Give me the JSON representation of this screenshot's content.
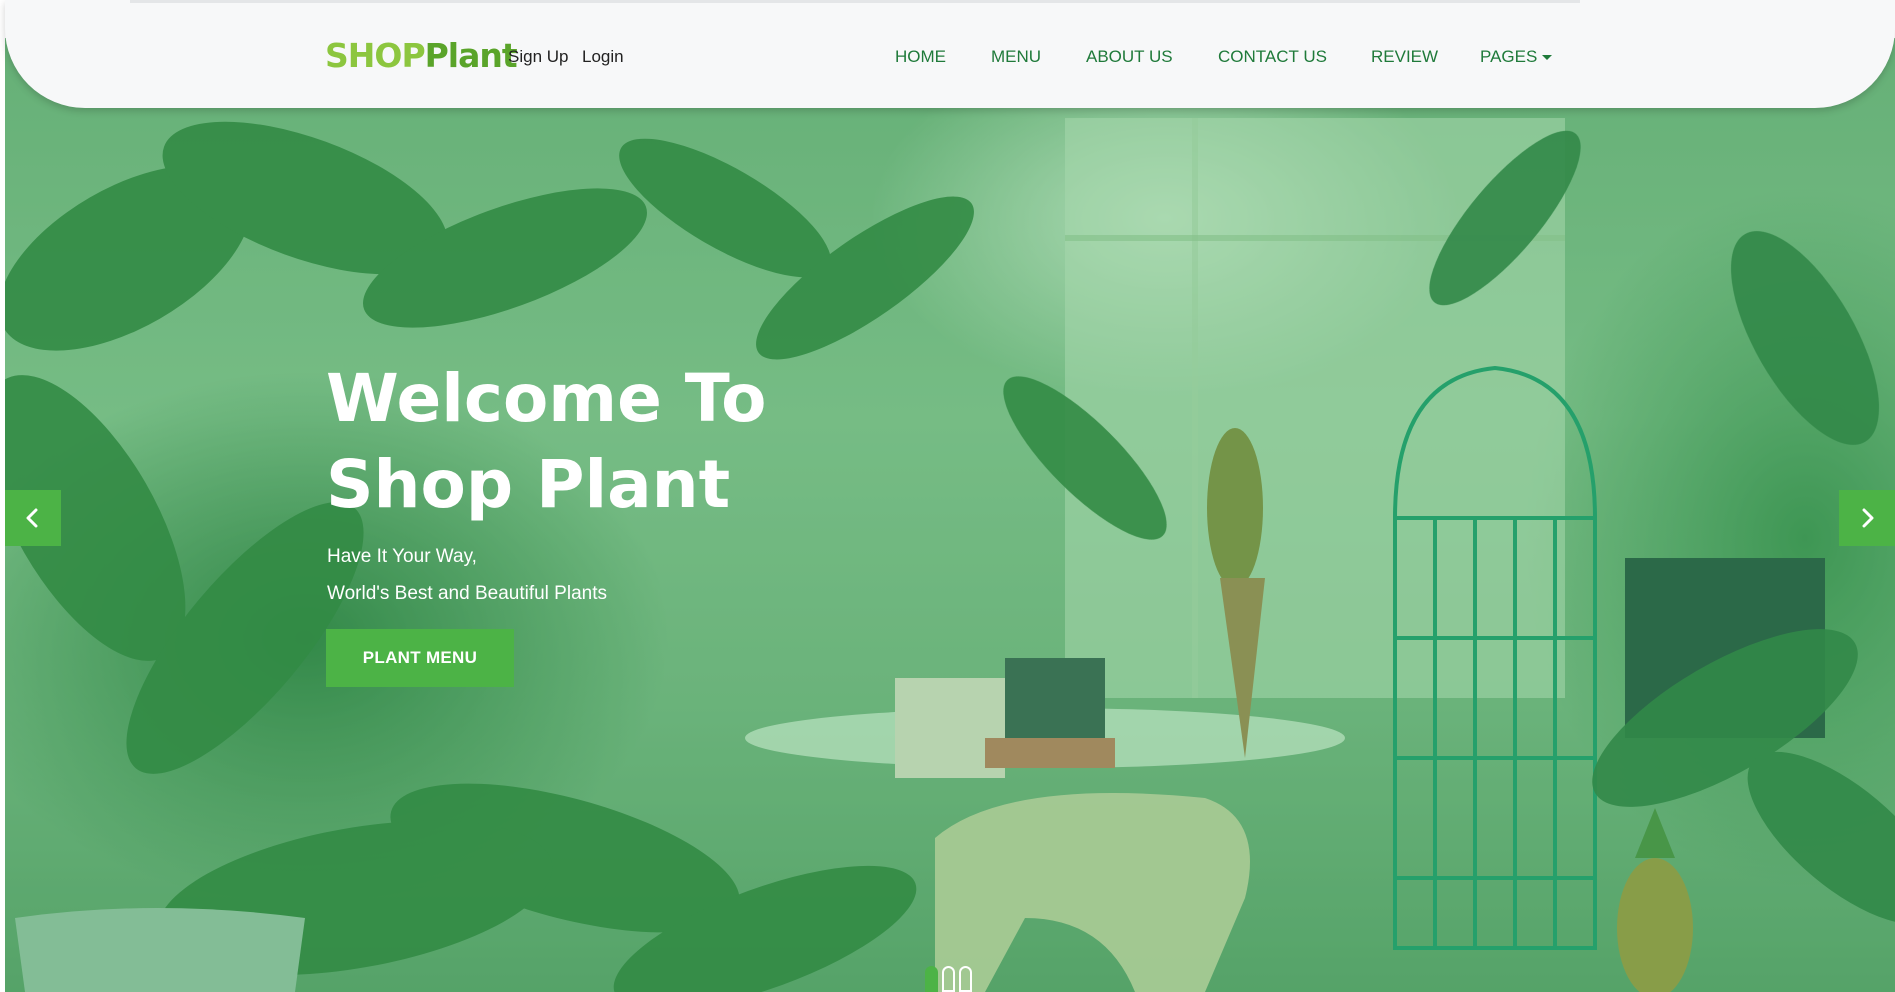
{
  "brand": {
    "logo_part1": "SHOP",
    "logo_part2": "Plant"
  },
  "auth": {
    "signup": "Sign Up",
    "login": "Login"
  },
  "nav": {
    "home": "HOME",
    "menu": "MENU",
    "about": "ABOUT US",
    "contact": "CONTACT US",
    "review": "REVIEW",
    "pages": "PAGES"
  },
  "hero": {
    "title_line1": "Welcome To",
    "title_line2": "Shop Plant",
    "subtitle_line1": "Have It Your Way,",
    "subtitle_line2": "World's Best and Beautiful Plants",
    "cta": "PLANT MENU"
  },
  "carousel": {
    "slide_count": 3,
    "active_slide": 1,
    "prev_icon": "chevron-left-icon",
    "next_icon": "chevron-right-icon"
  },
  "colors": {
    "accent": "#4cb346",
    "nav_text": "#1f7a3a",
    "logo_light": "#8cc63f",
    "logo_dark": "#5aa42a"
  }
}
